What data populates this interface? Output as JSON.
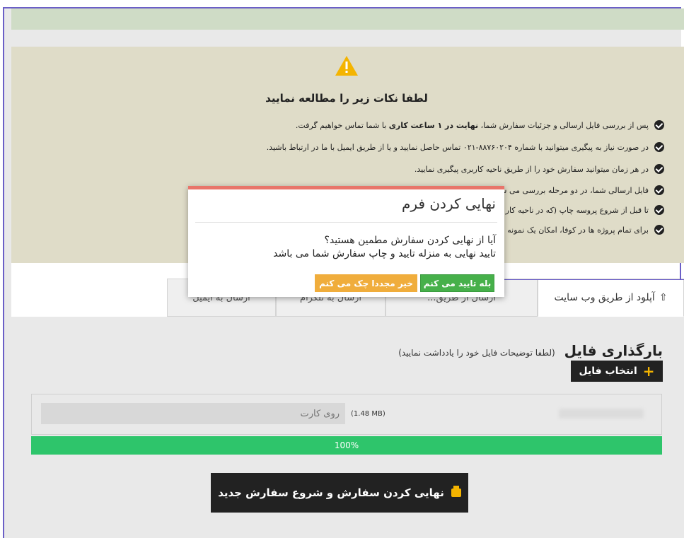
{
  "notice": {
    "title": "لطفا نکات زیر را مطالعه نمایید",
    "items": [
      {
        "pre": "پس از بررسی فایل ارسالی و جزئیات سفارش شما، ",
        "bold": "نهایت در ۱ ساعت کاری",
        "post": " با شما تماس خواهیم گرفت."
      },
      {
        "text": "در صورت نیاز به پیگیری میتوانید با شماره ۸۸۷۶۰۲۰۴-۰۲۱ تماس حاصل نمایید و یا از طریق ایمیل با ما در ارتباط باشید."
      },
      {
        "text": "در هر زمان میتوانید سفارش خود را از طریق ناحیه کاربری پیگیری نمایید."
      },
      {
        "text": "فایل ارسالی شما، در دو مرحله بررسی می ش                                                                                                                   حله ممکن است ساعاتی به طول بیانجامد."
      },
      {
        "text": "تا قبل از شروع پروسه چاپ (که در ناحیه کار                                                                                                               ساعت کاری به شما بازگردانده خواهد شد."
      },
      {
        "text": "برای تمام پروژه ها در کوفا، امکان یک نمونه                                                                                                                    ت (به این آدرس) مراجعه نمایید."
      }
    ]
  },
  "tabs": [
    {
      "label": "آپلود از طریق وب سایت"
    },
    {
      "label": "ارسال از طریق..."
    },
    {
      "label": "ارسال به تلگرام"
    },
    {
      "label": "ارسال به ایمیل"
    }
  ],
  "upload": {
    "title": "بارگذاری فایل",
    "hint": "(لطفا توضیحات فایل خود را یادداشت نمایید)",
    "select_button": "انتخاب فایل",
    "file_placeholder": "روی کارت",
    "file_size": "(1.48 MB)",
    "progress_percent": 100,
    "progress_label": "100%",
    "finalize_button": "نهایی کردن سفارش و شروع سفارش جدید"
  },
  "modal": {
    "title": "نهایی کردن فرم",
    "line1": "آیا از نهایی کردن سفارش مطمین هستید؟",
    "line2": "تایید نهایی به منزله تایید و چاپ سفارش شما می باشد",
    "yes_button": "بله تایید می کنم",
    "no_button": "خیر مجددا چک می کنم"
  },
  "colors": {
    "accent_green": "#2ec56b",
    "modal_top_border": "#e8756a",
    "warning_yellow": "#f4b400"
  }
}
